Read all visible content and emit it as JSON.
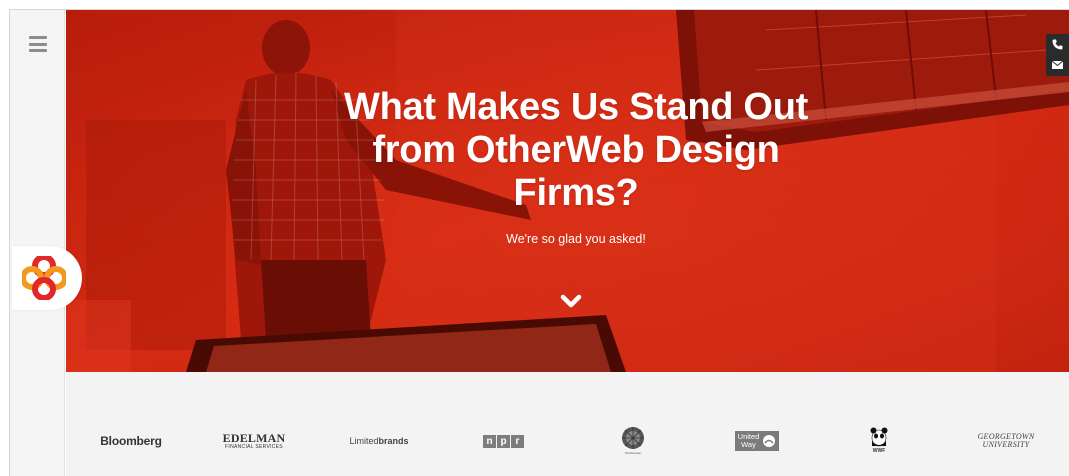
{
  "hero": {
    "title_line1": "What Makes Us Stand Out",
    "title_line2": "from OtherWeb Design",
    "title_line3": "Firms?",
    "subtitle": "We're so glad you asked!"
  },
  "sidebar": {
    "menu_icon": "hamburger-icon",
    "logo_icon": "brand-logo-icon"
  },
  "contact": {
    "phone_icon": "phone-icon",
    "email_icon": "mail-icon"
  },
  "clients": {
    "bloomberg": "Bloomberg",
    "edelman_main": "EDELMAN",
    "edelman_sub": "FINANCIAL SERVICES",
    "limited_prefix": "Limited",
    "limited_suffix": "brands",
    "npr": [
      "n",
      "p",
      "r"
    ],
    "smithsonian": "Smithsonian",
    "unitedway_line1": "United",
    "unitedway_line2": "Way",
    "wwf": "WWF",
    "georgetown_line1": "GEORGETOWN",
    "georgetown_line2": "UNIVERSITY"
  },
  "colors": {
    "hero_red": "#c8230f",
    "sidebar_bg": "#f5f5f5",
    "clients_bg": "#f3f3f3",
    "logo_orange": "#f39a1e",
    "logo_red": "#e2272b"
  }
}
